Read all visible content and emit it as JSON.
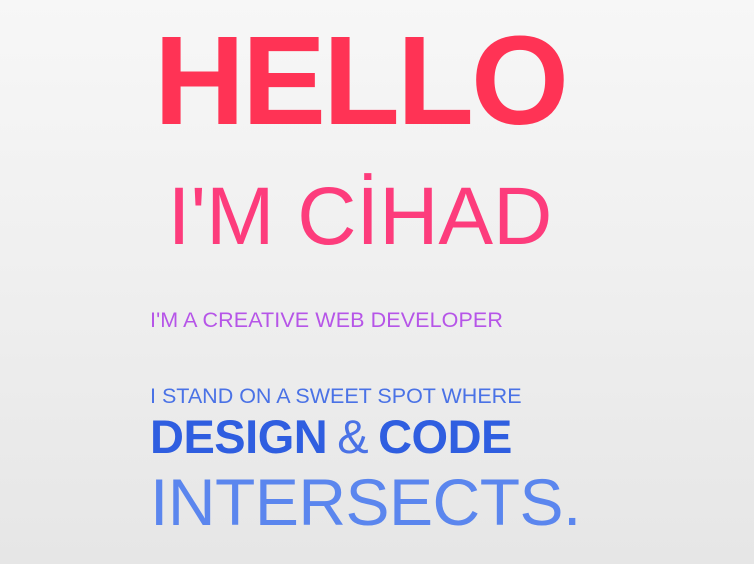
{
  "hero": {
    "greeting": "HELLO",
    "name_line": "I'M CİHAD",
    "role_line": "I'M A CREATIVE WEB DEVELOPER",
    "tagline_line1": "I STAND ON A SWEET SPOT WHERE",
    "design_word": "DESIGN",
    "ampersand": "&",
    "code_word": "CODE",
    "intersects_word": "INTERSECTS."
  },
  "colors": {
    "greeting": "#ff3355",
    "name": "#fd3c7c",
    "role": "#b655e8",
    "tagline": "#4a72e6",
    "design_code": "#2f5ee0",
    "intersects": "#5b86ee"
  }
}
